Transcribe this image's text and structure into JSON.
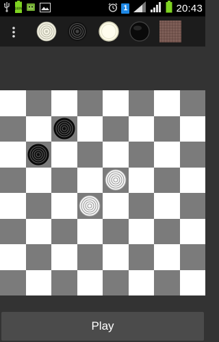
{
  "status_bar": {
    "time": "20:43",
    "sim_badge": "1",
    "battery_level_pct": 100,
    "icons": [
      "usb-icon",
      "battery-full-icon",
      "android-robot-icon",
      "picture-icon",
      "alarm-icon",
      "sim-1-icon",
      "signal-strength-icon",
      "signal-strength-icon",
      "battery-icon"
    ]
  },
  "toolbar": {
    "menu_icon": "overflow-menu-icon",
    "buttons": [
      {
        "name": "white-checker-style-button",
        "icon": "white-ringed-checker-icon"
      },
      {
        "name": "black-checker-style-button",
        "icon": "black-ringed-checker-icon"
      },
      {
        "name": "white-plain-piece-button",
        "icon": "white-plain-piece-icon"
      },
      {
        "name": "black-plain-piece-button",
        "icon": "black-plain-piece-icon"
      },
      {
        "name": "board-texture-button",
        "icon": "wood-texture-icon"
      }
    ]
  },
  "board": {
    "size": 8,
    "top_left_square": "light",
    "light_color": "#ffffff",
    "dark_color": "#7b7b7b",
    "pieces": [
      {
        "color": "black",
        "row": 1,
        "col": 2
      },
      {
        "color": "black",
        "row": 2,
        "col": 1
      },
      {
        "color": "white",
        "row": 3,
        "col": 4
      },
      {
        "color": "white",
        "row": 4,
        "col": 3
      }
    ]
  },
  "play_button": {
    "label": "Play"
  },
  "colors": {
    "background": "#333333",
    "toolbar": "#1c1c1c",
    "status_bar": "#000000",
    "play_button": "#4b4b4b",
    "battery": "#7ed321",
    "sim_badge": "#1e88e5"
  }
}
